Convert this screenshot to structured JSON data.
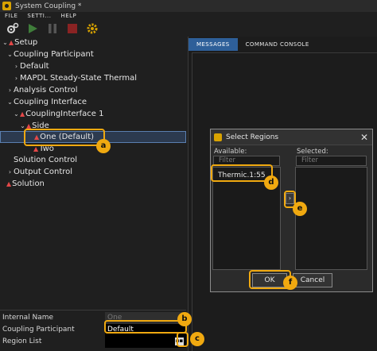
{
  "window": {
    "title": "System Coupling *"
  },
  "menu": [
    "File",
    "Setti...",
    "Help"
  ],
  "tree": {
    "items": [
      {
        "label": "Setup",
        "chevron": "⌄",
        "warning": true
      },
      {
        "label": "Coupling Participant",
        "chevron": "⌄",
        "warning": false
      },
      {
        "label": "Default",
        "chevron": "›",
        "warning": false
      },
      {
        "label": "MAPDL Steady-State Thermal",
        "chevron": "›",
        "warning": false
      },
      {
        "label": "Analysis Control",
        "chevron": "›",
        "warning": false
      },
      {
        "label": "Coupling Interface",
        "chevron": "⌄",
        "warning": false
      },
      {
        "label": "CouplingInterface 1",
        "chevron": "⌄",
        "warning": true
      },
      {
        "label": "Side",
        "chevron": "⌄",
        "warning": true
      },
      {
        "label": "One (Default)",
        "chevron": "",
        "warning": true
      },
      {
        "label": "Two",
        "chevron": "",
        "warning": true
      },
      {
        "label": "Solution Control",
        "chevron": "",
        "warning": false
      },
      {
        "label": "Output Control",
        "chevron": "›",
        "warning": false
      },
      {
        "label": "Solution",
        "chevron": "",
        "warning": true
      }
    ]
  },
  "properties": {
    "internal_name": {
      "label": "Internal Name",
      "value": "One"
    },
    "coupling_participant": {
      "label": "Coupling Participant",
      "value": "Default"
    },
    "region_list": {
      "label": "Region List",
      "value": ""
    }
  },
  "tabs": {
    "messages": "Messages",
    "console": "Command Console"
  },
  "dialog": {
    "title": "Select Regions",
    "close": "✕",
    "available_label": "Available:",
    "selected_label": "Selected:",
    "filter_placeholder": "Filter",
    "available_items": [
      "Thermic.1:55"
    ],
    "move_right": "›",
    "ok": "OK",
    "cancel": "Cancel"
  },
  "callouts": [
    "a",
    "b",
    "c",
    "d",
    "e",
    "f"
  ],
  "colors": {
    "callout": "#f0a910",
    "warning": "#e34848",
    "tab_active": "#2e5f99"
  }
}
